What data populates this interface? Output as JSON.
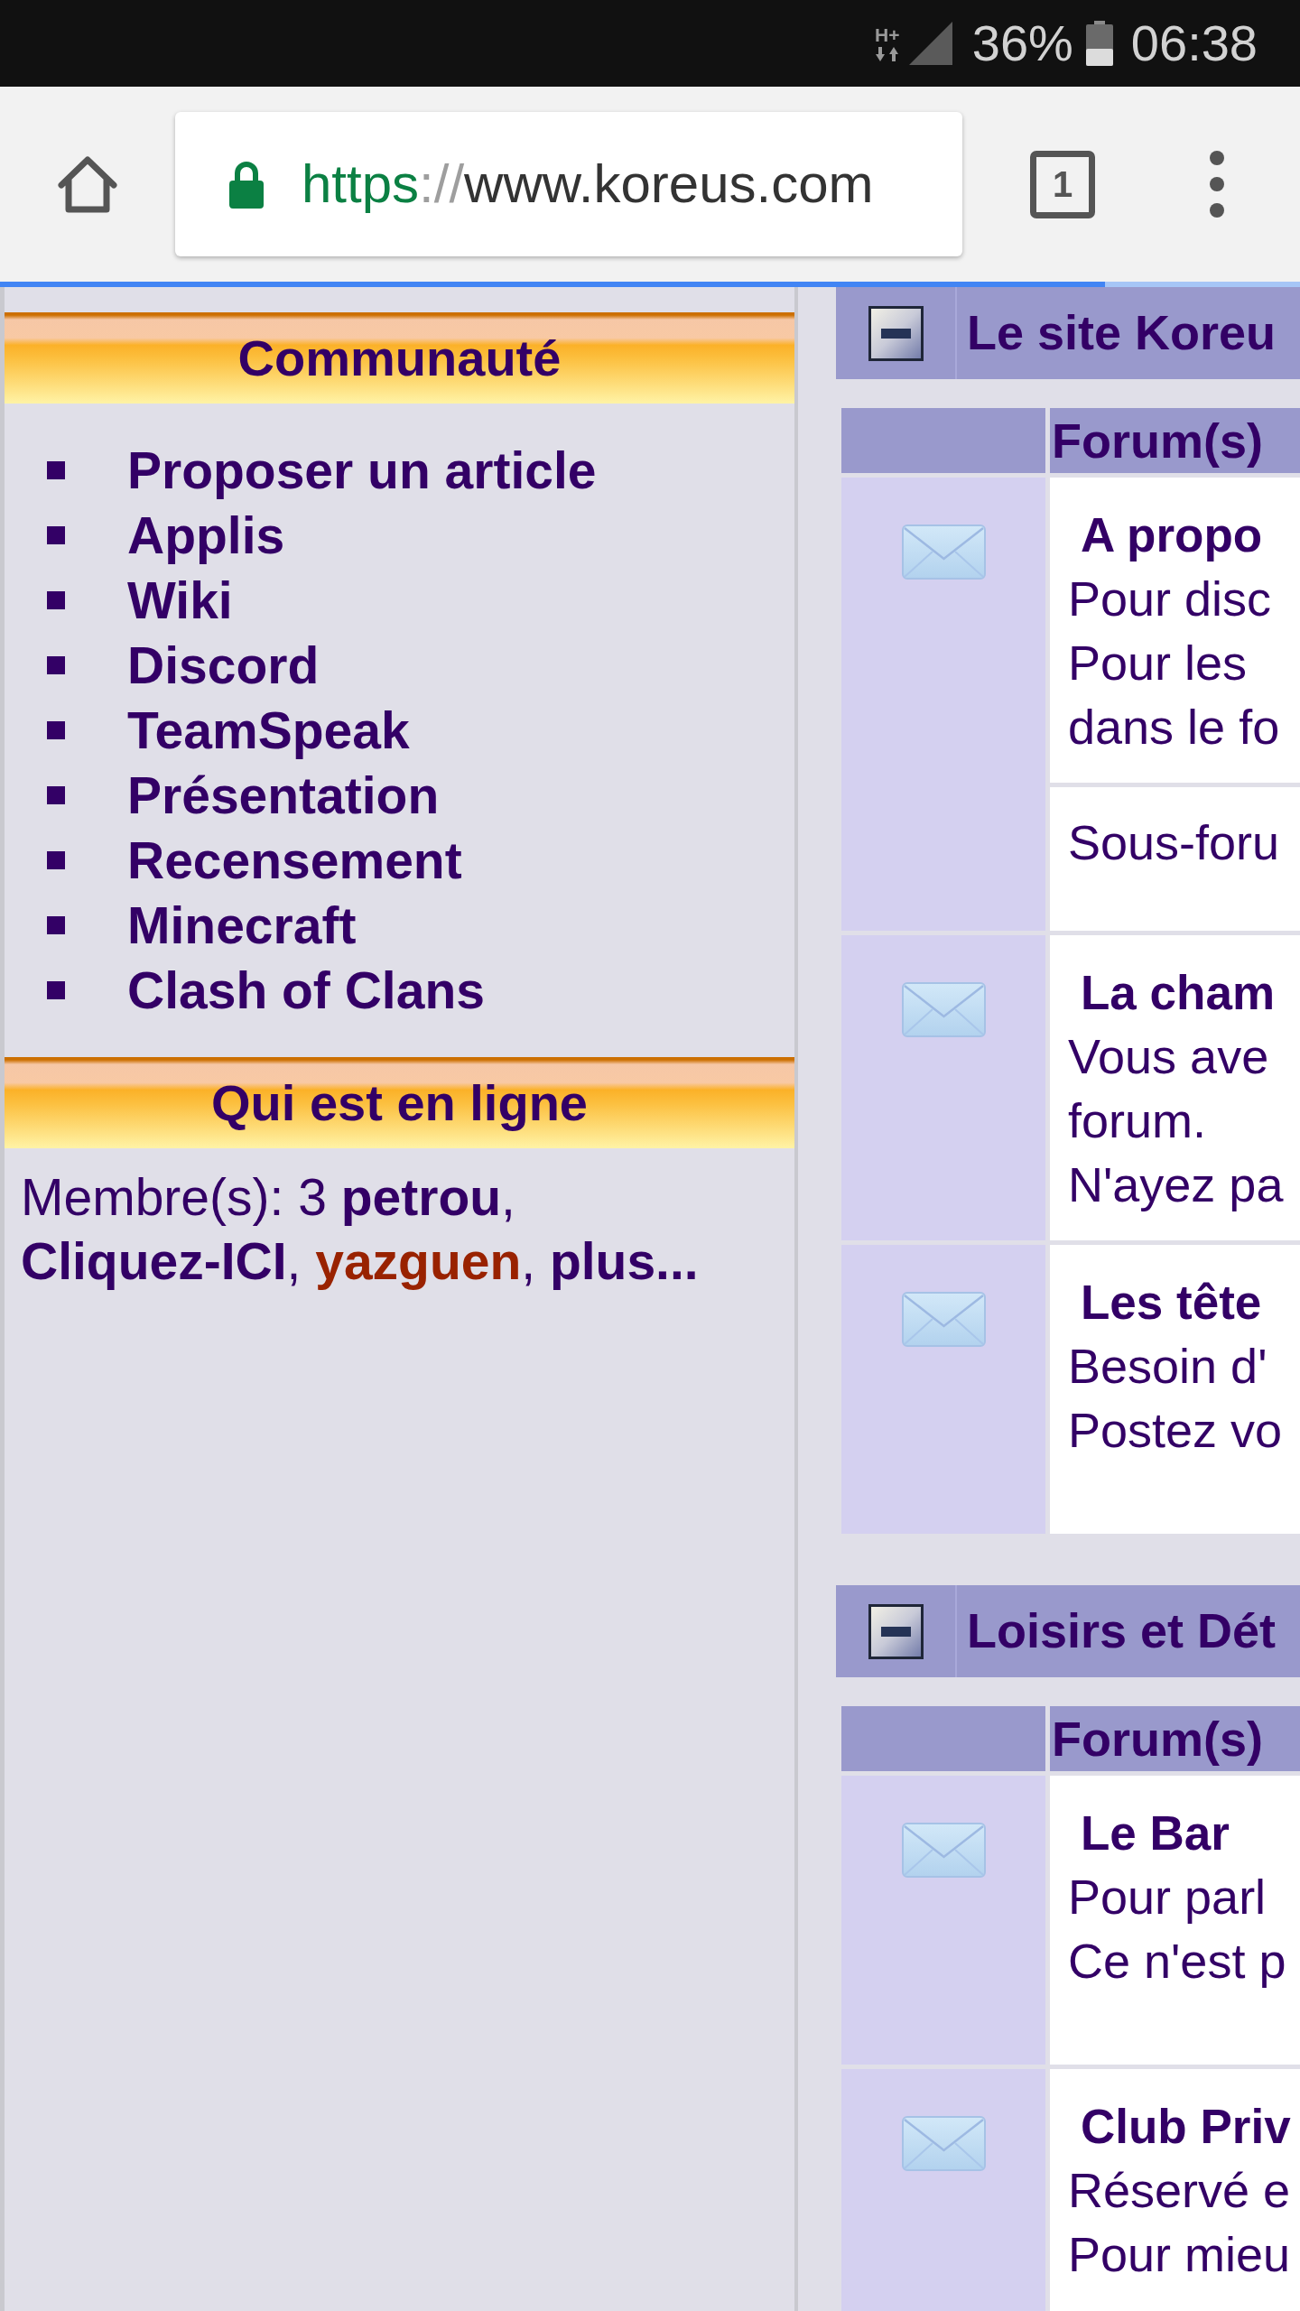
{
  "status_bar": {
    "network": "H+",
    "battery": "36%",
    "time": "06:38"
  },
  "browser": {
    "url": {
      "scheme": "https",
      "separator": "://",
      "host": "www.koreus.com"
    },
    "tab_count": "1",
    "progress": {
      "level": 0.85
    }
  },
  "sidebar": {
    "sections": [
      {
        "kind": "links",
        "title": "Communauté",
        "items": [
          "Proposer un article",
          "Applis",
          "Wiki",
          "Discord",
          "TeamSpeak",
          "Présentation",
          "Recensement",
          "Minecraft",
          "Clash of Clans"
        ]
      },
      {
        "kind": "online",
        "title": "Qui est en ligne",
        "label": "Membre(s): 3",
        "members": [
          {
            "name": "petrou",
            "color": "#330066"
          },
          {
            "name": "Cliquez-ICI",
            "color": "#330066"
          },
          {
            "name": "yazguen",
            "color": "#992200"
          }
        ],
        "separator": ",",
        "more": "plus..."
      }
    ]
  },
  "categories": [
    {
      "title": "Le site Koreu",
      "expanded": true,
      "column_header": "Forum(s)",
      "forums": [
        {
          "title": "A propo",
          "description": [
            "Pour disc",
            "Pour les",
            "dans le fo"
          ],
          "subforums": "Sous-foru"
        },
        {
          "title": "La cham",
          "description": [
            "Vous ave",
            "forum.",
            "N'ayez pa"
          ]
        },
        {
          "title": "Les tête",
          "description": [
            "Besoin d'",
            "Postez vo"
          ]
        }
      ]
    },
    {
      "title": "Loisirs et Dét",
      "expanded": true,
      "column_header": "Forum(s)",
      "forums": [
        {
          "title": "Le Bar",
          "description": [
            "Pour parl",
            "Ce n'est p"
          ]
        },
        {
          "title": "Club Priv",
          "description": [
            "Réservé e",
            "Pour mieu"
          ]
        }
      ]
    }
  ]
}
